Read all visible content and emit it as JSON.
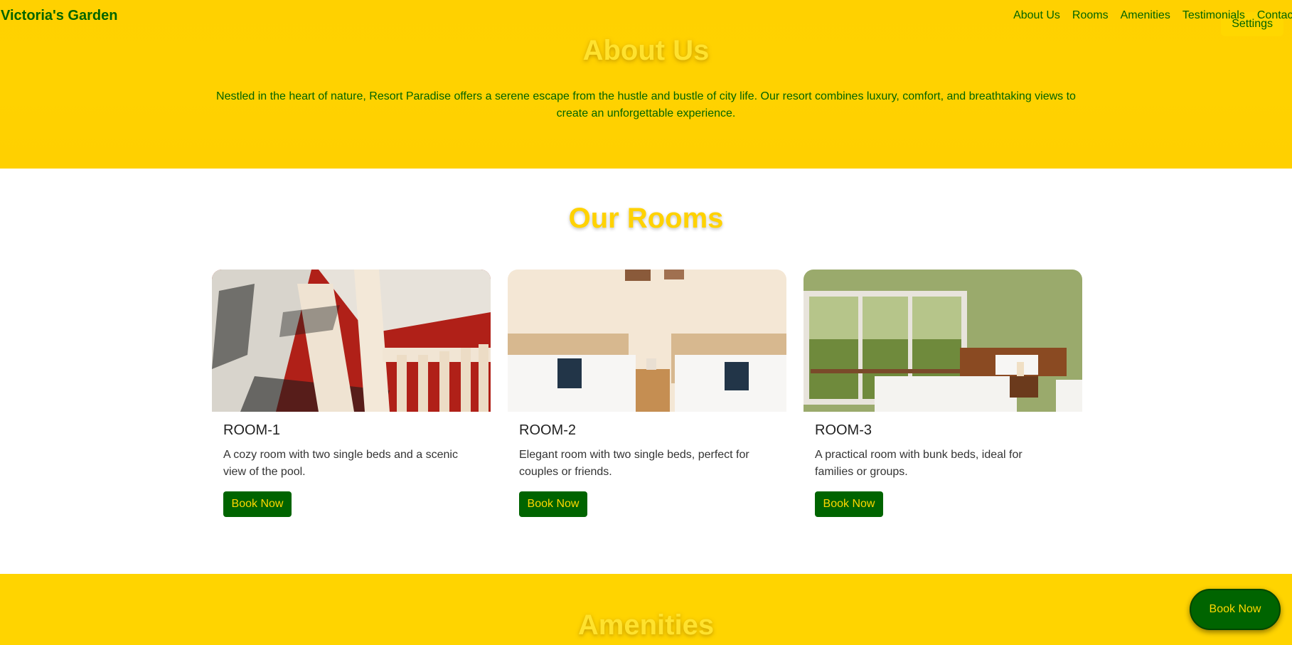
{
  "brand": "Victoria's Garden",
  "nav": {
    "links": [
      "About Us",
      "Rooms",
      "Amenities",
      "Testimonials",
      "Contact"
    ],
    "settings_label": "Settings"
  },
  "about": {
    "title": "About Us",
    "text": "Nestled in the heart of nature, Resort Paradise offers a serene escape from the hustle and bustle of city life. Our resort combines luxury, comfort, and breathtaking views to create an unforgettable experience."
  },
  "rooms": {
    "title": "Our Rooms",
    "cards": [
      {
        "name": "ROOM-1",
        "description": "A cozy room with two single beds and a scenic view of the pool.",
        "button": "Book Now"
      },
      {
        "name": "ROOM-2",
        "description": "Elegant room with two single beds, perfect for couples or friends.",
        "button": "Book Now"
      },
      {
        "name": "ROOM-3",
        "description": "A practical room with bunk beds, ideal for families or groups.",
        "button": "Book Now"
      }
    ]
  },
  "amenities": {
    "title": "Amenities"
  },
  "floating_button": "Book Now",
  "colors": {
    "primary_yellow": "#ffd700",
    "primary_green": "#006400"
  }
}
